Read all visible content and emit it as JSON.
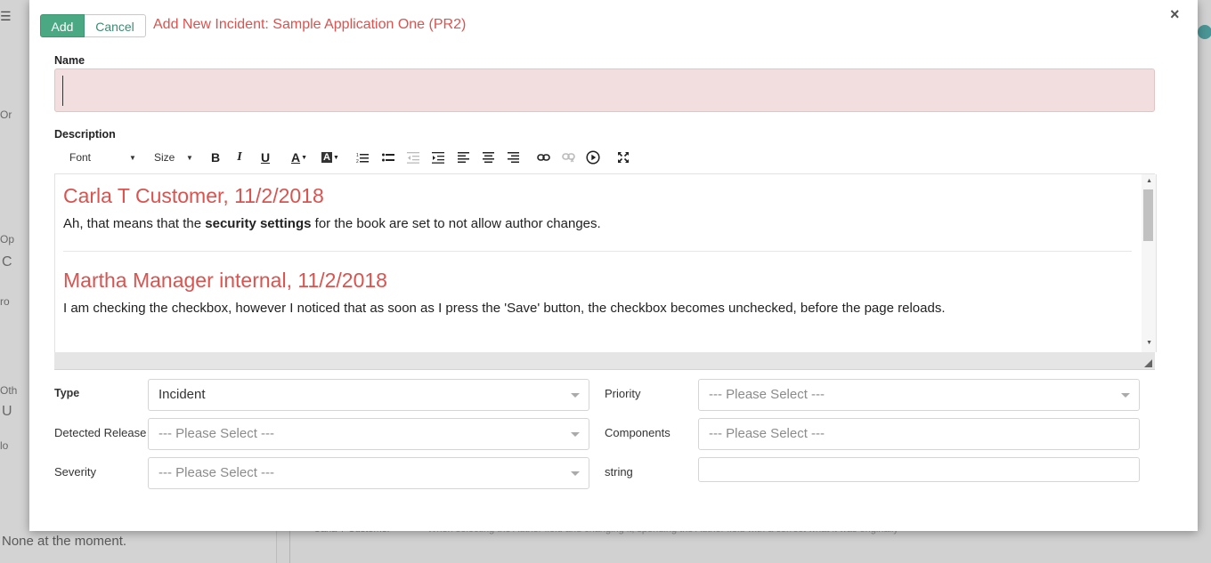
{
  "background": {
    "menu_icon": "☰",
    "fragments": [
      "Or",
      "Op",
      "C",
      "ro",
      "Oth",
      "U",
      "lo"
    ],
    "none_text": "None at the moment.",
    "bottom_faint_left": "Carla T Customer",
    "bottom_faint_right": "When selecting the Author field and changing it, spending the Author field with a correct what it was originally"
  },
  "modal": {
    "add_label": "Add",
    "cancel_label": "Cancel",
    "title": "Add New Incident: Sample Application One (PR2)",
    "close_icon": "×"
  },
  "form": {
    "name_label": "Name",
    "name_value": "",
    "description_label": "Description"
  },
  "toolbar": {
    "font_label": "Font",
    "size_label": "Size",
    "icons": [
      "bold-icon",
      "italic-icon",
      "underline-icon",
      "text-color-icon",
      "background-color-icon",
      "numbered-list-icon",
      "bulleted-list-icon",
      "decrease-indent-icon",
      "increase-indent-icon",
      "align-left-icon",
      "align-center-icon",
      "align-right-icon",
      "link-icon",
      "unlink-icon",
      "media-embed-icon",
      "maximize-icon"
    ]
  },
  "editor": {
    "entries": [
      {
        "heading": "Carla T Customer, 11/2/2018",
        "text_before": "Ah, that means that the ",
        "text_bold": "security settings",
        "text_after": " for the book are set to not allow author changes."
      },
      {
        "heading": "Martha Manager internal, 11/2/2018",
        "text": "I am checking the checkbox, however I noticed that as soon as I press the 'Save' button, the checkbox becomes unchecked, before the page reloads."
      }
    ]
  },
  "fields": {
    "type_label": "Type",
    "type_value": "Incident",
    "priority_label": "Priority",
    "priority_value": "--- Please Select ---",
    "detected_release_label": "Detected Release",
    "detected_release_value": "--- Please Select ---",
    "components_label": "Components",
    "components_value": "--- Please Select ---",
    "severity_label": "Severity",
    "severity_value": "--- Please Select ---",
    "string_label": "string",
    "string_value": ""
  },
  "colors": {
    "accent_green": "#4aa883",
    "title_red": "#d9534f",
    "error_input_bg": "#f2dede"
  }
}
